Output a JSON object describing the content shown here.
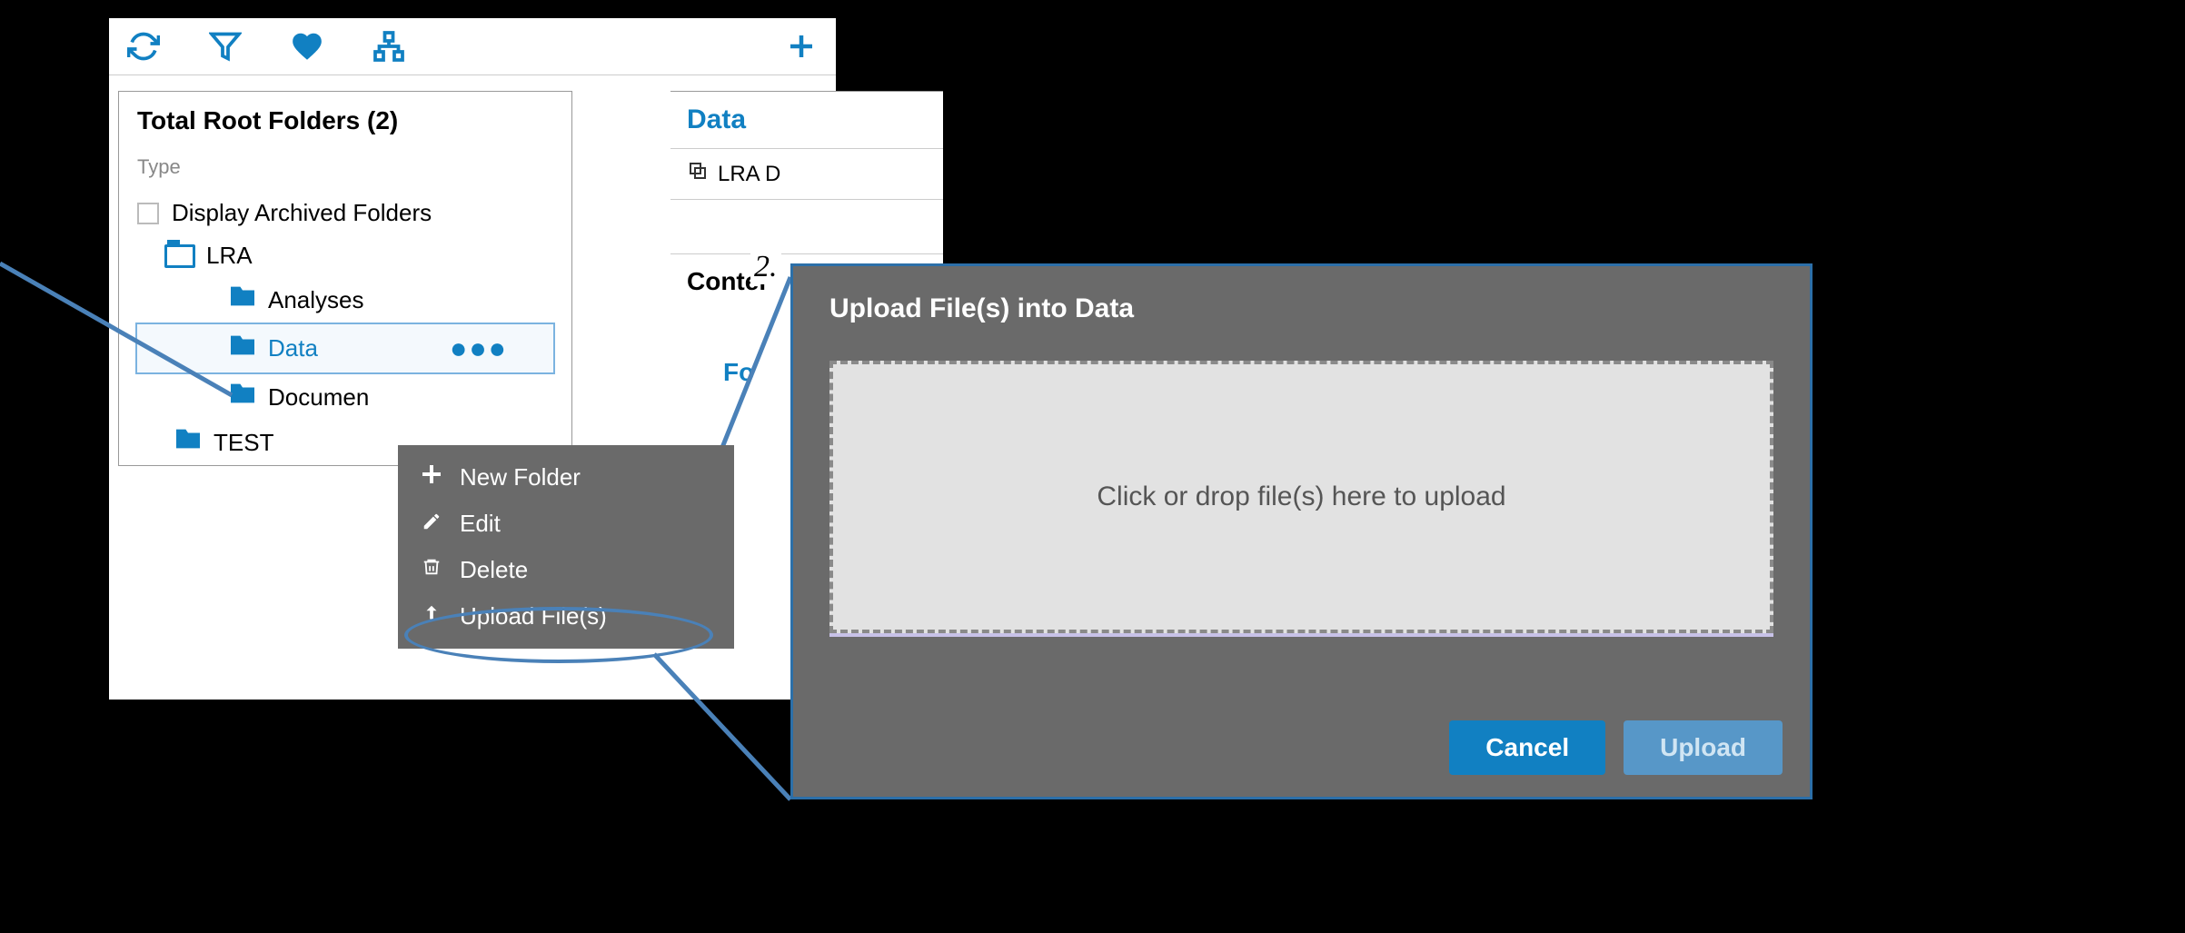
{
  "tree": {
    "header": "Total Root Folders (2)",
    "type_label": "Type",
    "archived_label": "Display Archived Folders",
    "nodes": {
      "lra": "LRA",
      "analyses": "Analyses",
      "data": "Data",
      "documents": "Documen",
      "test": "TEST"
    },
    "dots": "●●●"
  },
  "detail": {
    "title": "Data",
    "breadcrumb": "LRA D",
    "section": "Conter",
    "tab": "Fo"
  },
  "menu": {
    "new_folder": "New Folder",
    "edit": "Edit",
    "delete": "Delete",
    "upload": "Upload File(s)"
  },
  "dialog": {
    "title": "Upload File(s) into Data",
    "drop_text": "Click or drop file(s) here to upload",
    "cancel": "Cancel",
    "upload": "Upload"
  },
  "annotation": {
    "step": "2."
  }
}
